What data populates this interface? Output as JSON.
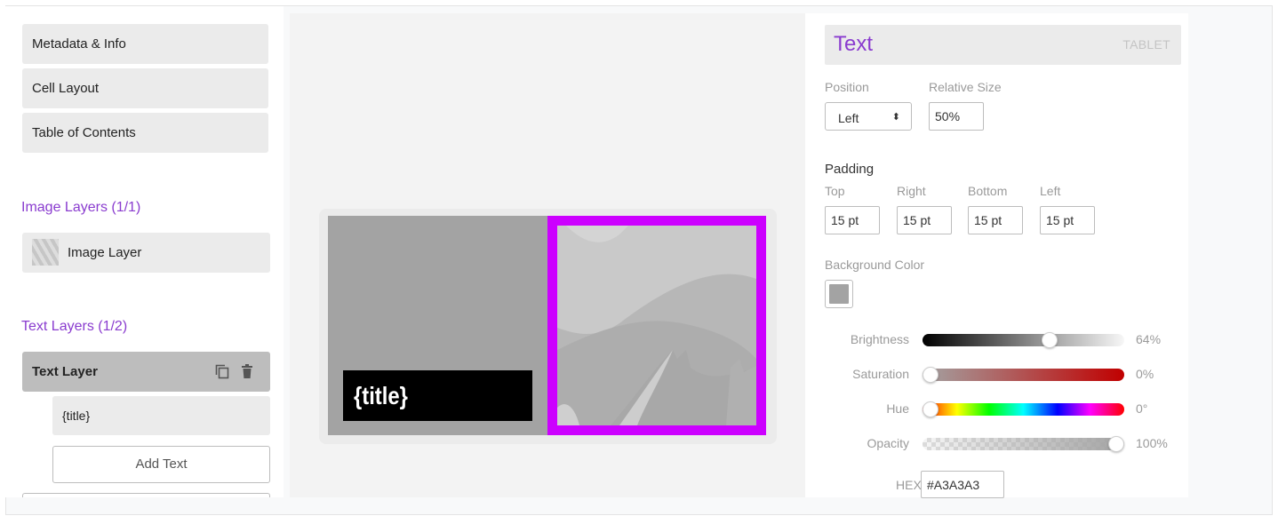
{
  "sidebar": {
    "nav": [
      {
        "label": "Metadata & Info"
      },
      {
        "label": "Cell Layout"
      },
      {
        "label": "Table of Contents"
      }
    ],
    "image_layers": {
      "title": "Image Layers (1/1)",
      "items": [
        {
          "label": "Image Layer"
        }
      ]
    },
    "text_layers": {
      "title": "Text Layers (1/2)",
      "selected": "Text Layer",
      "sub_items": [
        {
          "label": "{title}"
        }
      ],
      "add_label": "Add Text"
    }
  },
  "canvas": {
    "title_text": "{title}",
    "background_color": "#a3a3a3",
    "highlight_color": "#cc00ff"
  },
  "panel": {
    "title": "Text",
    "device": "TABLET",
    "position": {
      "label": "Position",
      "value": "Left"
    },
    "relative_size": {
      "label": "Relative Size",
      "value": "50%"
    },
    "padding": {
      "label": "Padding",
      "top": {
        "label": "Top",
        "value": "15 pt"
      },
      "right": {
        "label": "Right",
        "value": "15 pt"
      },
      "bottom": {
        "label": "Bottom",
        "value": "15 pt"
      },
      "left": {
        "label": "Left",
        "value": "15 pt"
      }
    },
    "background_color": {
      "label": "Background Color",
      "swatch": "#a3a3a3"
    },
    "sliders": [
      {
        "label": "Brightness",
        "value": "64%",
        "fraction": 0.64
      },
      {
        "label": "Saturation",
        "value": "0%",
        "fraction": 0
      },
      {
        "label": "Hue",
        "value": "0°",
        "fraction": 0
      },
      {
        "label": "Opacity",
        "value": "100%",
        "fraction": 1
      }
    ],
    "hex": {
      "label": "HEX",
      "value": "#A3A3A3"
    }
  }
}
